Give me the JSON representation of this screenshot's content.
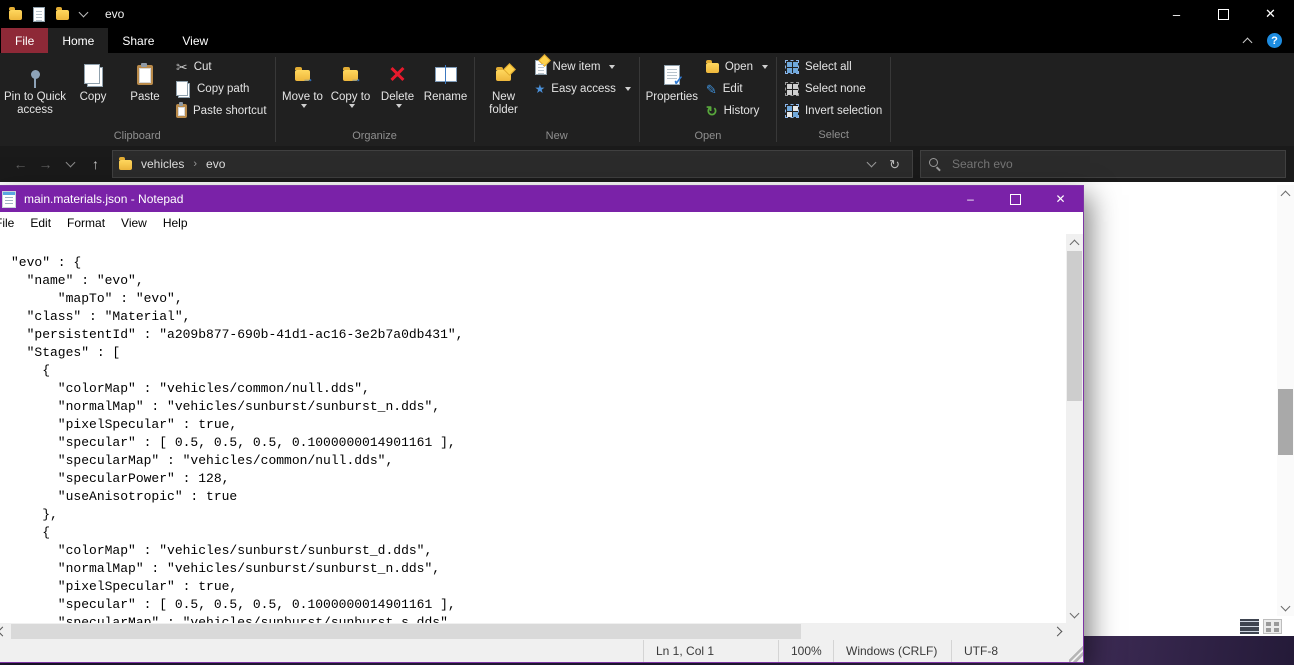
{
  "icons": {
    "cut": "✂",
    "delete": "✕",
    "close": "✕",
    "minimize": "–",
    "edit": "✎",
    "history": "↻",
    "refresh": "↻",
    "back": "←",
    "forward": "→",
    "up": "↑",
    "check": "✓",
    "star": "★",
    "help": "?",
    "breadcrumb_sep": "›"
  },
  "colors": {
    "explorer_titlebar": "#000000",
    "ribbon_bg": "#202020",
    "file_tab": "#8e2937",
    "notepad_titlebar": "#7a22a8",
    "desktop": "#32234a"
  },
  "explorer": {
    "title": "evo",
    "tabs": [
      {
        "label": "File"
      },
      {
        "label": "Home"
      },
      {
        "label": "Share"
      },
      {
        "label": "View"
      }
    ],
    "ribbon": {
      "clipboard": {
        "label": "Clipboard",
        "pin": "Pin to Quick access",
        "copy": "Copy",
        "paste": "Paste",
        "cut": "Cut",
        "copy_path": "Copy path",
        "paste_shortcut": "Paste shortcut"
      },
      "organize": {
        "label": "Organize",
        "move_to": "Move to",
        "copy_to": "Copy to",
        "delete": "Delete",
        "rename": "Rename"
      },
      "new_group": {
        "label": "New",
        "new_folder": "New folder",
        "new_item": "New item",
        "easy_access": "Easy access"
      },
      "open_group": {
        "label": "Open",
        "properties": "Properties",
        "open": "Open",
        "edit": "Edit",
        "history": "History"
      },
      "select_group": {
        "label": "Select",
        "select_all": "Select all",
        "select_none": "Select none",
        "invert": "Invert selection"
      }
    },
    "navbar": {
      "breadcrumb": [
        "vehicles",
        "evo"
      ],
      "search_placeholder": "Search evo"
    }
  },
  "notepad": {
    "title": "main.materials.json - Notepad",
    "menus": [
      "File",
      "Edit",
      "Format",
      "View",
      "Help"
    ],
    "lines": [
      "",
      "\"evo\" : {",
      "  \"name\" : \"evo\",",
      "      \"mapTo\" : \"evo\",",
      "  \"class\" : \"Material\",",
      "  \"persistentId\" : \"a209b877-690b-41d1-ac16-3e2b7a0db431\",",
      "  \"Stages\" : [",
      "    {",
      "      \"colorMap\" : \"vehicles/common/null.dds\",",
      "      \"normalMap\" : \"vehicles/sunburst/sunburst_n.dds\",",
      "      \"pixelSpecular\" : true,",
      "      \"specular\" : [ 0.5, 0.5, 0.5, 0.1000000014901161 ],",
      "      \"specularMap\" : \"vehicles/common/null.dds\",",
      "      \"specularPower\" : 128,",
      "      \"useAnisotropic\" : true",
      "    },",
      "    {",
      "      \"colorMap\" : \"vehicles/sunburst/sunburst_d.dds\",",
      "      \"normalMap\" : \"vehicles/sunburst/sunburst_n.dds\",",
      "      \"pixelSpecular\" : true,",
      "      \"specular\" : [ 0.5, 0.5, 0.5, 0.1000000014901161 ],",
      "      \"specularMap\" : \"vehicles/sunburst/sunburst_s.dds\","
    ],
    "status": {
      "cursor": "Ln 1, Col 1",
      "zoom": "100%",
      "line_ending": "Windows (CRLF)",
      "encoding": "UTF-8"
    }
  }
}
